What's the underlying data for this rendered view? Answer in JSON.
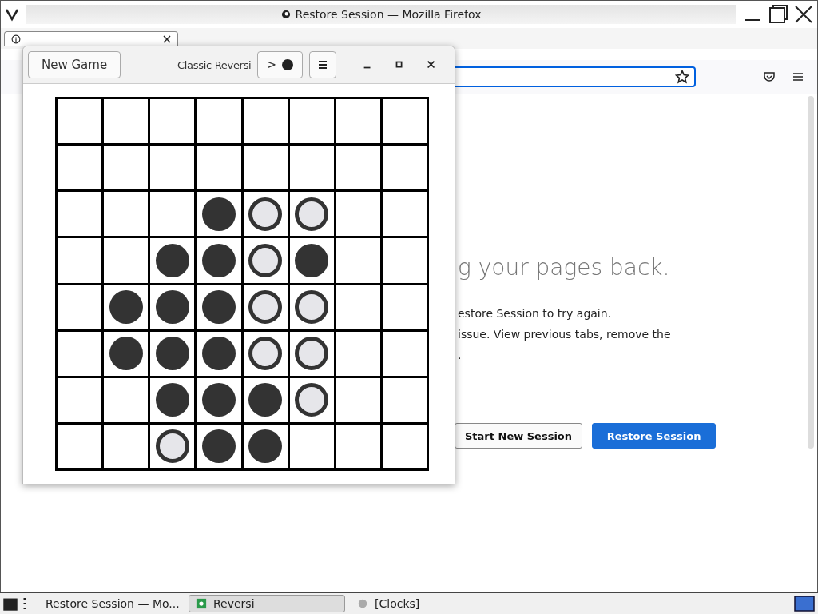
{
  "browser": {
    "title": "Restore Session — Mozilla Firefox",
    "content": {
      "heading": "g your pages back.",
      "lines": [
        "estore Session to try again.",
        "issue. View previous tabs, remove the",
        "."
      ],
      "buttons": [
        {
          "label": "Start New Session",
          "kind": "secondary"
        },
        {
          "label": "Restore Session",
          "kind": "primary"
        }
      ]
    }
  },
  "game": {
    "new_game": "New Game",
    "title": "Classic Reversi",
    "turn": {
      "arrow": ">",
      "dark": true
    },
    "board": [
      [
        {
          "kind": "empty"
        },
        {
          "kind": "empty"
        },
        {
          "kind": "empty"
        },
        {
          "kind": "empty"
        },
        {
          "kind": "empty"
        },
        {
          "kind": "empty"
        },
        {
          "kind": "empty"
        },
        {
          "kind": "empty"
        }
      ],
      [
        {
          "kind": "empty"
        },
        {
          "kind": "empty"
        },
        {
          "kind": "empty"
        },
        {
          "kind": "empty"
        },
        {
          "kind": "empty"
        },
        {
          "kind": "empty"
        },
        {
          "kind": "empty"
        },
        {
          "kind": "empty"
        }
      ],
      [
        {
          "kind": "empty"
        },
        {
          "kind": "empty"
        },
        {
          "kind": "empty"
        },
        {
          "kind": "dark"
        },
        {
          "kind": "light"
        },
        {
          "kind": "light"
        },
        {
          "kind": "empty"
        },
        {
          "kind": "empty"
        }
      ],
      [
        {
          "kind": "empty"
        },
        {
          "kind": "empty"
        },
        {
          "kind": "dark"
        },
        {
          "kind": "dark"
        },
        {
          "kind": "light"
        },
        {
          "kind": "dark"
        },
        {
          "kind": "empty"
        },
        {
          "kind": "empty"
        }
      ],
      [
        {
          "kind": "empty"
        },
        {
          "kind": "dark"
        },
        {
          "kind": "dark"
        },
        {
          "kind": "dark"
        },
        {
          "kind": "light"
        },
        {
          "kind": "light"
        },
        {
          "kind": "empty"
        },
        {
          "kind": "empty"
        }
      ],
      [
        {
          "kind": "empty"
        },
        {
          "kind": "dark"
        },
        {
          "kind": "dark"
        },
        {
          "kind": "dark"
        },
        {
          "kind": "light"
        },
        {
          "kind": "light"
        },
        {
          "kind": "empty"
        },
        {
          "kind": "empty"
        }
      ],
      [
        {
          "kind": "empty"
        },
        {
          "kind": "empty"
        },
        {
          "kind": "dark"
        },
        {
          "kind": "dark"
        },
        {
          "kind": "dark"
        },
        {
          "kind": "light"
        },
        {
          "kind": "empty"
        },
        {
          "kind": "empty"
        }
      ],
      [
        {
          "kind": "empty"
        },
        {
          "kind": "empty"
        },
        {
          "kind": "light"
        },
        {
          "kind": "dark"
        },
        {
          "kind": "dark"
        },
        {
          "kind": "empty"
        },
        {
          "kind": "empty"
        },
        {
          "kind": "empty"
        }
      ]
    ]
  },
  "taskbar": {
    "items": [
      {
        "label": "Restore Session — Mo...",
        "selected": false
      },
      {
        "label": "Reversi",
        "selected": true
      },
      {
        "label": "[Clocks]",
        "selected": false
      }
    ]
  }
}
